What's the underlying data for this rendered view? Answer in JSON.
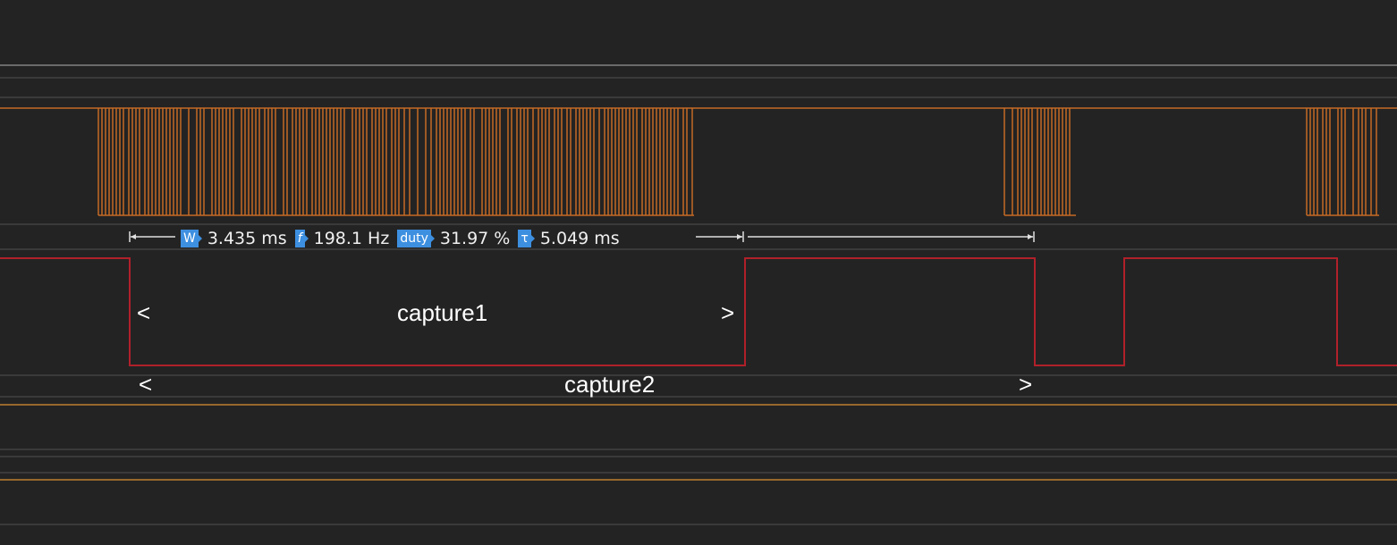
{
  "colors": {
    "background": "#232323",
    "separator": "#3e3e3e",
    "digital_trace": "#c46a25",
    "pwm_trace": "#b0202a",
    "level_line": "#c08030",
    "text": "#ffffff",
    "badge": "#3d8fe0"
  },
  "measurements": {
    "width": {
      "badge": "W",
      "value": "3.435 ms"
    },
    "frequency": {
      "badge": "f",
      "value": "198.1 Hz"
    },
    "duty": {
      "badge": "duty",
      "value": "31.97 %"
    },
    "period": {
      "badge": "τ",
      "value": "5.049 ms"
    }
  },
  "captures": [
    {
      "label": "capture1",
      "open": "<",
      "close": ">"
    },
    {
      "label": "capture2",
      "open": "<",
      "close": ">"
    }
  ]
}
